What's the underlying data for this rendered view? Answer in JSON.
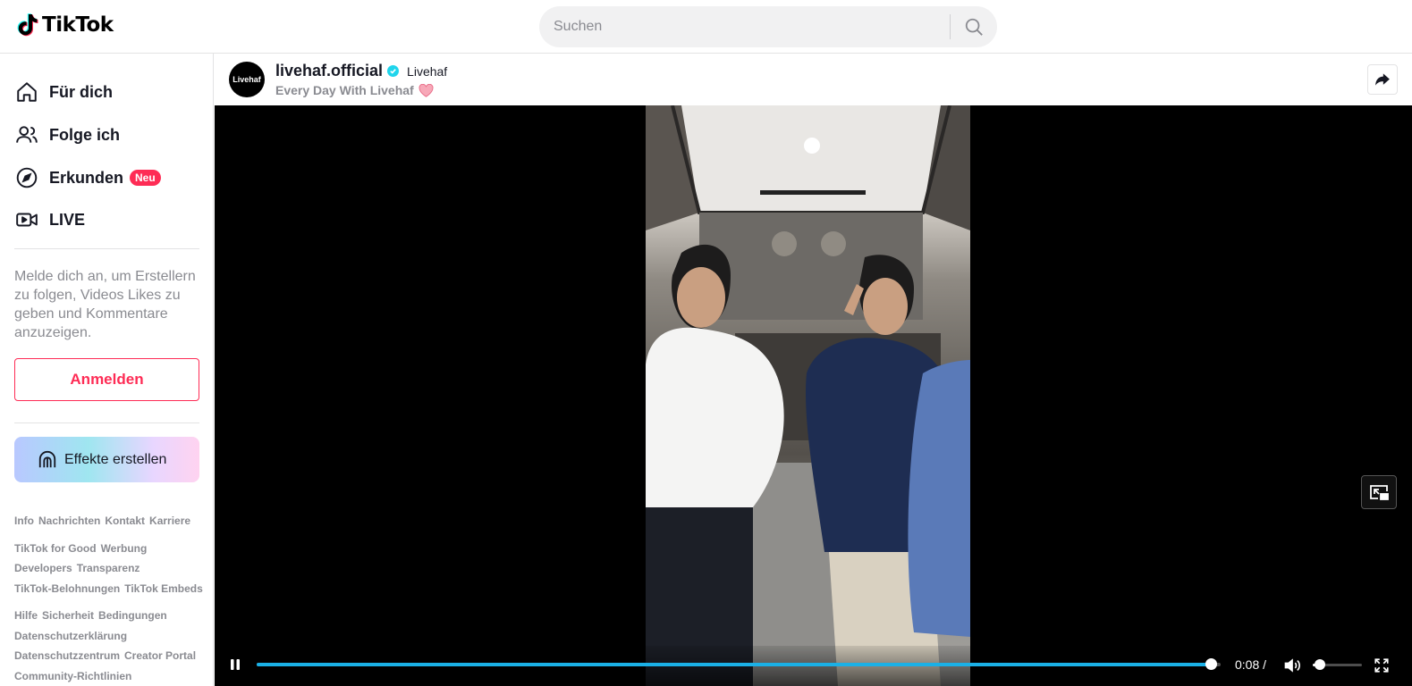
{
  "header": {
    "logo_text": "TikTok",
    "search_placeholder": "Suchen"
  },
  "sidebar": {
    "nav": [
      {
        "label": "Für dich",
        "icon": "home-icon"
      },
      {
        "label": "Folge ich",
        "icon": "following-icon"
      },
      {
        "label": "Erkunden",
        "icon": "compass-icon",
        "badge": "Neu"
      },
      {
        "label": "LIVE",
        "icon": "live-camera-icon"
      }
    ],
    "login_hint": "Melde dich an, um Erstellern zu folgen, Videos Likes zu geben und Kommentare anzuzeigen.",
    "login_button": "Anmelden",
    "effects_button": "Effekte erstellen",
    "footer": {
      "group1": [
        "Info",
        "Nachrichten",
        "Kontakt",
        "Karriere"
      ],
      "group2": [
        "TikTok for Good",
        "Werbung",
        "Developers",
        "Transparenz",
        "TikTok-Belohnungen",
        "TikTok Embeds"
      ],
      "group3": [
        "Hilfe",
        "Sicherheit",
        "Bedingungen",
        "Datenschutzerklärung",
        "Datenschutzzentrum",
        "Creator Portal",
        "Community-Richtlinien"
      ]
    }
  },
  "video": {
    "author_avatar_text": "Livehaf",
    "author_handle": "livehaf.official",
    "author_nickname": "Livehaf",
    "description": "Every Day With Livehaf",
    "time": "0:08 /",
    "progress": 0.99,
    "volume": 0.05
  },
  "colors": {
    "brand_pink": "#fe2c55",
    "progress_blue": "#1ab0e6",
    "verified_cyan": "#20d5ec"
  }
}
